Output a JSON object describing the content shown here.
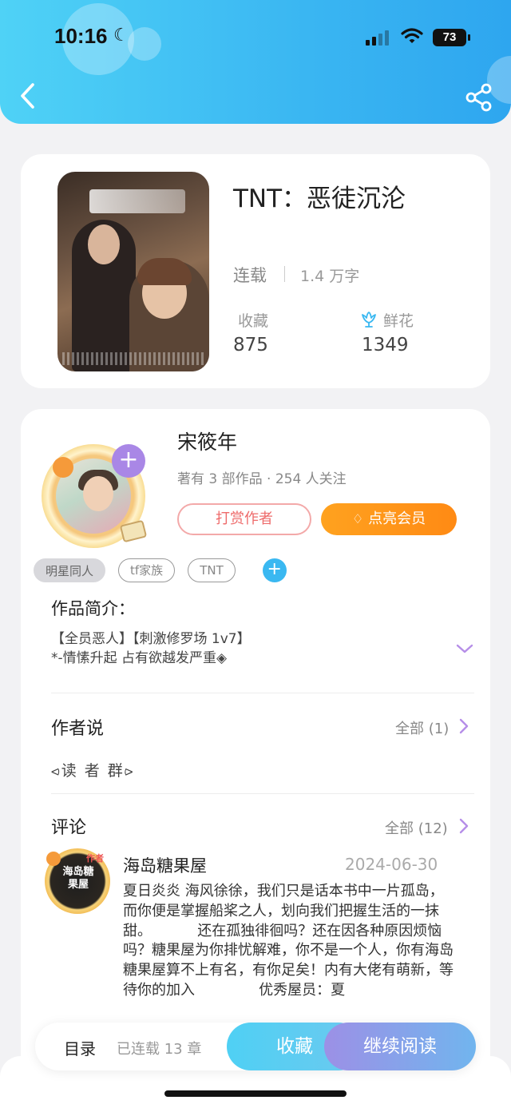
{
  "status_bar": {
    "time": "10:16",
    "battery": "73"
  },
  "book": {
    "title": "TNT：恶徒沉沦",
    "status": "连载",
    "words": "1.4 万字",
    "favorites_label": "收藏",
    "favorites_count": "875",
    "flowers_label": "鲜花",
    "flowers_count": "1349"
  },
  "author": {
    "name": "宋筱年",
    "meta": "著有 3 部作品 · 254 人关注",
    "tip_label": "打赏作者",
    "vip_label": "点亮会员"
  },
  "tags": [
    "明星同人",
    "tf家族",
    "TNT"
  ],
  "intro": {
    "title": "作品简介：",
    "line1": "【全员恶人】【刺激修罗场  1v7】",
    "line2": "*-情愫升起 占有欲越发严重◈"
  },
  "author_says": {
    "title": "作者说",
    "all_label": "全部 (1)",
    "content": "⪦读 者 群⪧"
  },
  "comments": {
    "title": "评论",
    "all_label": "全部 (12)",
    "first": {
      "avatar_text": "海岛糖果屋",
      "avatar_badge": "作者",
      "user": "海岛糖果屋",
      "date": "2024-06-30",
      "text": "夏日炎炎 海风徐徐，我们只是话本书中一片孤岛，而你便是掌握船桨之人，划向我们把握生活的一抹甜。          还在孤独徘徊吗？还在因各种原因烦恼吗？糖果屋为你排忧解难，你不是一个人，你有海岛\n糖果屋算不上有名，有你足矣！内有大佬有萌新，等待你的加入              优秀屋员：夏"
    }
  },
  "bottom_bar": {
    "toc_label": "目录",
    "chapters": "已连载 13 章",
    "favorite_label": "收藏",
    "read_label": "继续阅读"
  },
  "colors": {
    "header_blue": "#3ab6f2",
    "accent_purple": "#a987e6",
    "vip_orange": "#ff8a14",
    "tip_red": "#ee6b6b"
  }
}
